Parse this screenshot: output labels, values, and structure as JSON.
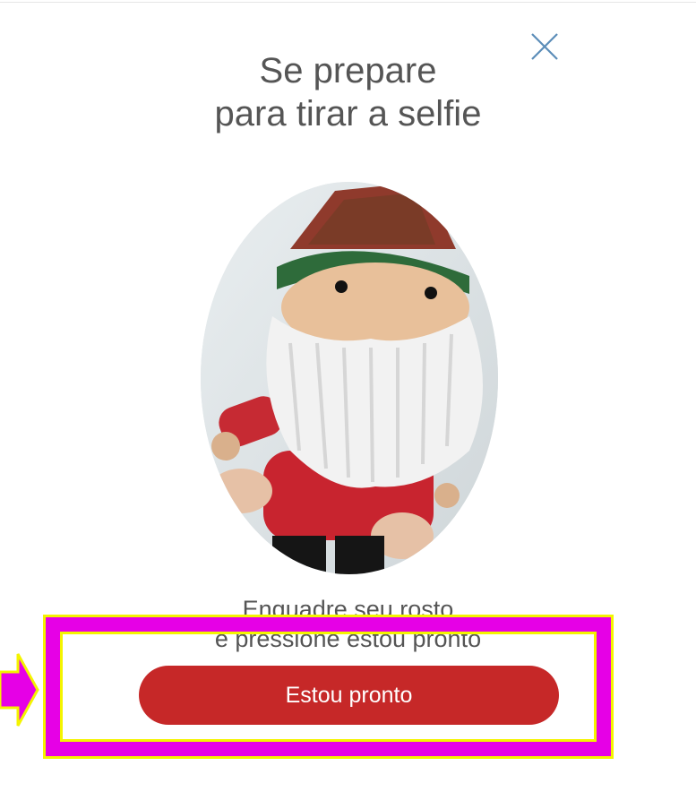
{
  "header": {
    "title_line1": "Se prepare",
    "title_line2": "para tirar a selfie"
  },
  "close_button": {
    "icon": "close-icon",
    "color": "#5b8db8"
  },
  "photo": {
    "subject": "crocheted gnome doll"
  },
  "instructions": {
    "line1": "Enquadre seu rosto",
    "line2": "e pressione estou pronto"
  },
  "primary_button": {
    "label": "Estou pronto",
    "color": "#c62828"
  },
  "highlight": {
    "border_color": "#e600e6",
    "outline_color": "#f4f400",
    "pointer_icon": "arrow-right-icon"
  }
}
